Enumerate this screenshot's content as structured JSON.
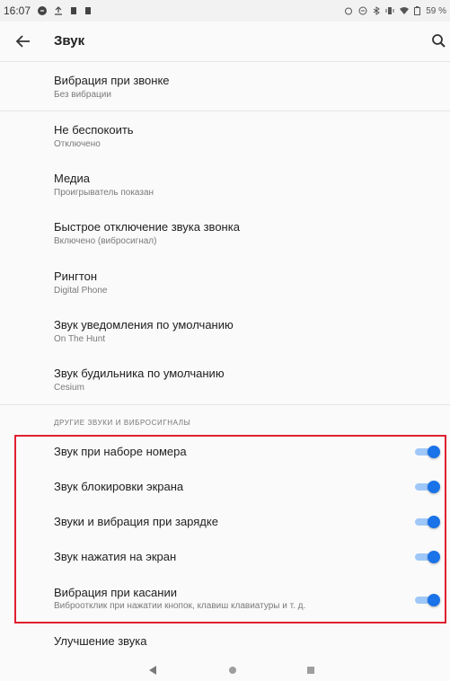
{
  "status_bar": {
    "time": "16:07",
    "battery": "59 %",
    "left_icons": [
      "notification-icon",
      "upload-icon",
      "sim-icon",
      "sim-icon"
    ],
    "right_icons": [
      "alarm-icon",
      "dnd-icon",
      "bluetooth-icon",
      "vibrate-icon",
      "wifi-icon",
      "battery-icon"
    ]
  },
  "app_bar": {
    "title": "Звук",
    "back_icon": "arrow-left-icon",
    "search_icon": "search-icon"
  },
  "items": [
    {
      "title": "Вибрация при звонке",
      "subtitle": "Без вибрации"
    },
    {
      "title": "Не беспокоить",
      "subtitle": "Отключено"
    },
    {
      "title": "Медиа",
      "subtitle": "Проигрыватель показан"
    },
    {
      "title": "Быстрое отключение звука звонка",
      "subtitle": "Включено (вибросигнал)"
    },
    {
      "title": "Рингтон",
      "subtitle": "Digital Phone"
    },
    {
      "title": "Звук уведомления по умолчанию",
      "subtitle": "On The Hunt"
    },
    {
      "title": "Звук будильника по умолчанию",
      "subtitle": "Cesium"
    }
  ],
  "section_header": "ДРУГИЕ ЗВУКИ И ВИБРОСИГНАЛЫ",
  "toggles": [
    {
      "title": "Звук при наборе номера",
      "subtitle": "",
      "on": true
    },
    {
      "title": "Звук блокировки экрана",
      "subtitle": "",
      "on": true
    },
    {
      "title": "Звуки и вибрация при зарядке",
      "subtitle": "",
      "on": true
    },
    {
      "title": "Звук нажатия на экран",
      "subtitle": "",
      "on": true
    },
    {
      "title": "Вибрация при касании",
      "subtitle": "Виброотклик при нажатии кнопок, клавиш клавиатуры и т. д.",
      "on": true
    }
  ],
  "footer_item": {
    "title": "Улучшение звука"
  },
  "colors": {
    "accent": "#1a73e8",
    "accent_track": "#9fc8f8",
    "highlight": "#e02030",
    "background": "#fafafa"
  },
  "nav_bar": {
    "icons": [
      "back-triangle-icon",
      "home-circle-icon",
      "recents-square-icon"
    ]
  }
}
